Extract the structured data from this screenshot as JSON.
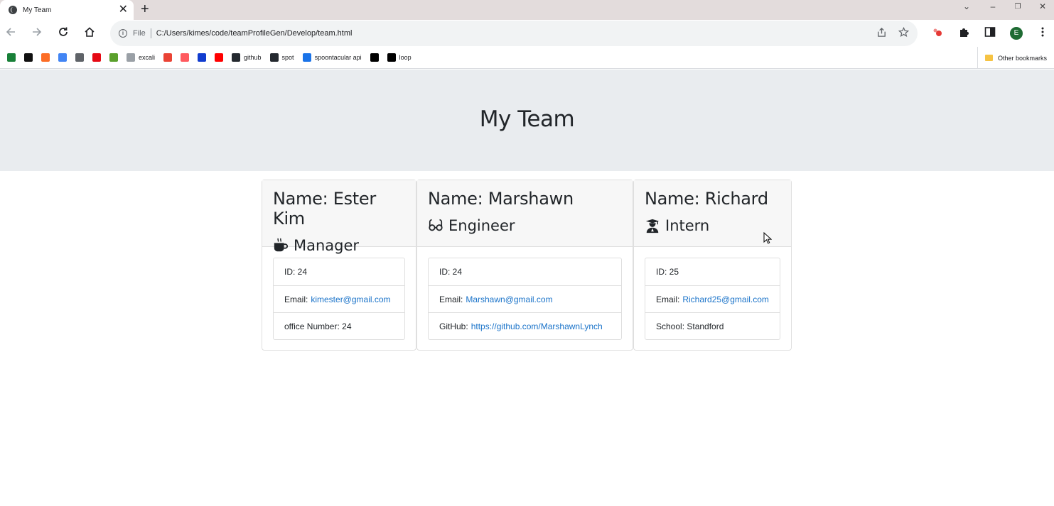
{
  "browser": {
    "tab_title": "My Team",
    "tab_close": "✕",
    "new_tab": "+",
    "scheme_label": "File",
    "url": "C:/Users/kimes/code/teamProfileGen/Develop/team.html",
    "profile_initial": "E",
    "window_controls": [
      "⌄",
      "–",
      "❐",
      "✕"
    ]
  },
  "bookmarks": {
    "items": [
      {
        "icon": "sheets-icon",
        "label": "",
        "color": "#188038"
      },
      {
        "icon": "amazon-icon",
        "label": "",
        "color": "#111111"
      },
      {
        "icon": "gitlab-icon",
        "label": "",
        "color": "#fc6d26"
      },
      {
        "icon": "calendar-icon",
        "label": "",
        "color": "#4285f4"
      },
      {
        "icon": "docs-icon",
        "label": "",
        "color": "#5f6368"
      },
      {
        "icon": "netflix-icon",
        "label": "",
        "color": "#e50914"
      },
      {
        "icon": "green-app-icon",
        "label": "",
        "color": "#5aa02c"
      },
      {
        "icon": "excalidraw-icon",
        "label": "excali",
        "color": "#9aa0a6"
      },
      {
        "icon": "gmail-icon",
        "label": "",
        "color": "#ea4335"
      },
      {
        "icon": "airbnb-icon",
        "label": "",
        "color": "#ff5a5f"
      },
      {
        "icon": "disney-icon",
        "label": "",
        "color": "#113ccf"
      },
      {
        "icon": "youtube-icon",
        "label": "",
        "color": "#ff0000"
      },
      {
        "icon": "github-icon",
        "label": "github",
        "color": "#24292f"
      },
      {
        "icon": "spot-icon",
        "label": "spot",
        "color": "#24292f"
      },
      {
        "icon": "spoontacular-icon",
        "label": "spoontacular api",
        "color": "#1a73e8"
      },
      {
        "icon": "dev-icon",
        "label": "",
        "color": "#000000"
      },
      {
        "icon": "loop-icon",
        "label": "loop",
        "color": "#000000"
      }
    ],
    "other_label": "Other bookmarks"
  },
  "page": {
    "title": "My Team"
  },
  "team": [
    {
      "name": "Name: Ester Kim",
      "role": "Manager",
      "role_icon": "coffee-mug-icon",
      "id_label": "ID: 24",
      "email_label": "Email:",
      "email": "kimester@gmail.com",
      "extra_label": "office Number: 24",
      "extra_link": ""
    },
    {
      "name": "Name: Marshawn",
      "role": "Engineer",
      "role_icon": "glasses-icon",
      "id_label": "ID: 24",
      "email_label": "Email:",
      "email": "Marshawn@gmail.com",
      "extra_label": "GitHub:",
      "extra_link": "https://github.com/MarshawnLynch"
    },
    {
      "name": "Name: Richard",
      "role": "Intern",
      "role_icon": "graduate-icon",
      "id_label": "ID: 25",
      "email_label": "Email:",
      "email": "Richard25@gmail.com",
      "extra_label": "School: Standford",
      "extra_link": ""
    }
  ],
  "colors": {
    "link": "#1a73c9",
    "hero_bg": "#e9ecef",
    "card_header_bg": "#f7f7f7"
  }
}
